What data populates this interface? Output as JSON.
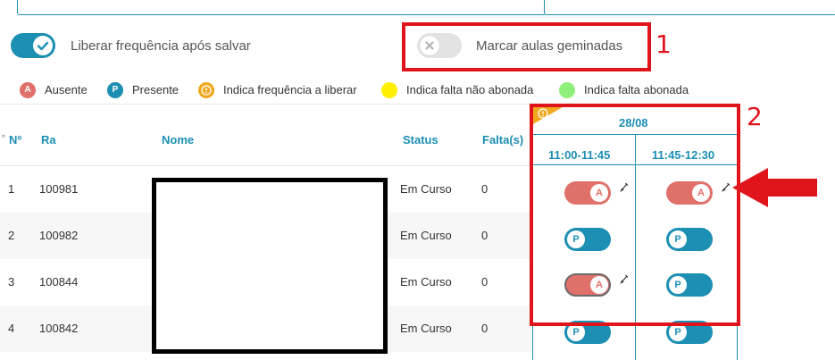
{
  "top_toggle": {
    "label": "Liberar frequência após salvar",
    "state": "on"
  },
  "geminadas_toggle": {
    "label": "Marcar aulas geminadas",
    "state": "off"
  },
  "annotations": [
    "1",
    "2"
  ],
  "legend": [
    {
      "letter": "A",
      "label": "Ausente",
      "color": "#e0706a"
    },
    {
      "letter": "P",
      "label": "Presente",
      "color": "#1c8fb3"
    },
    {
      "letter": "!",
      "label": "Indica frequência a liberar",
      "color": "#f0a81d"
    },
    {
      "letter": "",
      "label": "Indica falta não abonada",
      "color": "#ffef00"
    },
    {
      "letter": "",
      "label": "Indica falta abonada",
      "color": "#8ef07a"
    }
  ],
  "table": {
    "headers": {
      "num": "Nº",
      "ra": "Ra",
      "nome": "Nome",
      "status": "Status",
      "faltas": "Falta(s)"
    },
    "date": "28/08",
    "slots": [
      "11:00-11:45",
      "11:45-12:30"
    ],
    "rows": [
      {
        "num": "1",
        "ra": "100981",
        "status": "Em Curso",
        "faltas": "0",
        "slot1": "A",
        "slot2": "A"
      },
      {
        "num": "2",
        "ra": "100982",
        "status": "Em Curso",
        "faltas": "0",
        "slot1": "P",
        "slot2": "P"
      },
      {
        "num": "3",
        "ra": "100844",
        "status": "Em Curso",
        "faltas": "0",
        "slot1": "A",
        "slot2": "P"
      },
      {
        "num": "4",
        "ra": "100842",
        "status": "Em Curso",
        "faltas": "0",
        "slot1": "P",
        "slot2": "P"
      }
    ]
  },
  "icons": {
    "warning": "warning-icon",
    "pencil": "pencil-icon",
    "arrow": "red-arrow-icon",
    "close": "close-icon",
    "check": "check-icon"
  }
}
